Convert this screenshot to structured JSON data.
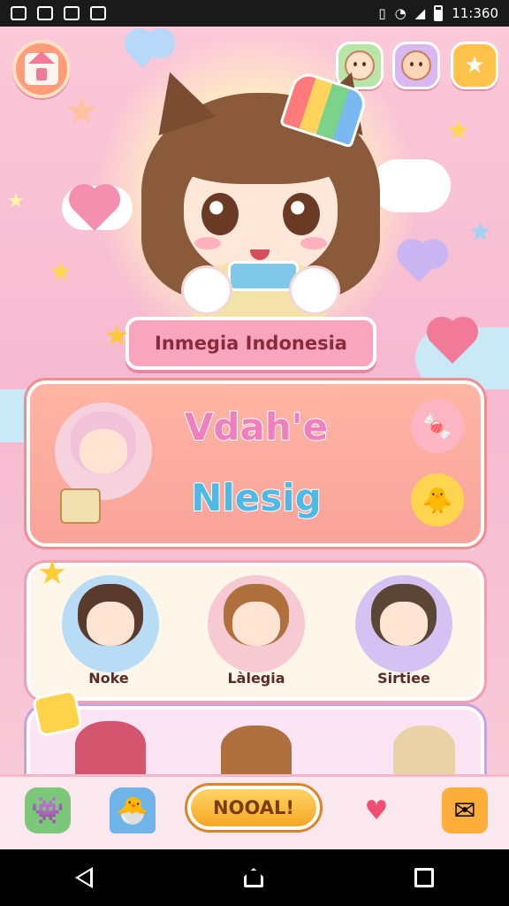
{
  "status_bar": {
    "time": "11:360"
  },
  "header": {
    "title": "Inmegia Indonesia"
  },
  "main_panel": {
    "label_1": "Vdah'e",
    "label_2": "Nlesig"
  },
  "characters": [
    {
      "name": "Noke"
    },
    {
      "name": "Làlegia"
    },
    {
      "name": "Sirtiee"
    }
  ],
  "dock": {
    "cta_label": "NOOAL!"
  },
  "colors": {
    "accent_pink": "#f7a6bd",
    "accent_orange": "#f5a623",
    "accent_blue": "#4fb9e6"
  }
}
